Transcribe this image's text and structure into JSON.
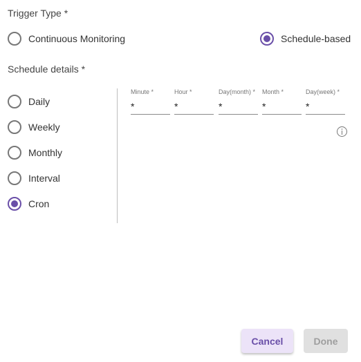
{
  "trigger": {
    "title": "Trigger Type *",
    "options": [
      {
        "label": "Continuous Monitoring",
        "checked": false
      },
      {
        "label": "Schedule-based",
        "checked": true
      }
    ]
  },
  "schedule": {
    "title": "Schedule details *",
    "options": [
      {
        "label": "Daily",
        "checked": false
      },
      {
        "label": "Weekly",
        "checked": false
      },
      {
        "label": "Monthly",
        "checked": false
      },
      {
        "label": "Interval",
        "checked": false
      },
      {
        "label": "Cron",
        "checked": true
      }
    ],
    "cron_fields": [
      {
        "label": "Minute *",
        "value": "*"
      },
      {
        "label": "Hour *",
        "value": "*"
      },
      {
        "label": "Day(month) *",
        "value": "*"
      },
      {
        "label": "Month *",
        "value": "*"
      },
      {
        "label": "Day(week) *",
        "value": "*"
      }
    ]
  },
  "actions": {
    "cancel_label": "Cancel",
    "done_label": "Done"
  },
  "colors": {
    "accent": "#6a4fa8",
    "cancel_bg": "#ece3f8",
    "done_bg": "#e0e0e0"
  },
  "icons": {
    "info": "info-circle-icon"
  }
}
